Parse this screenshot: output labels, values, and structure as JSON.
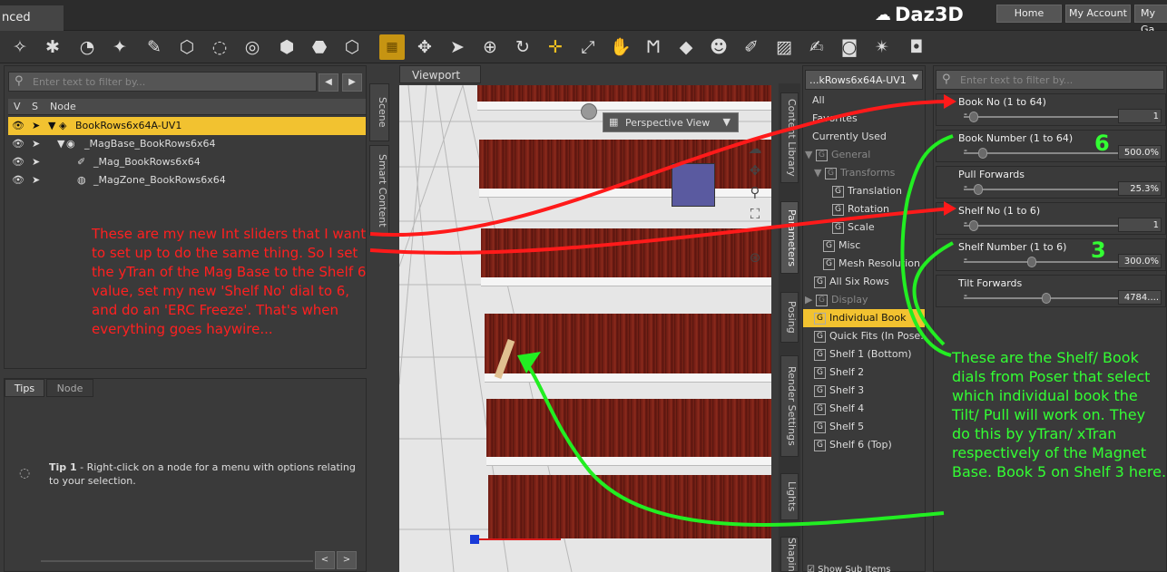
{
  "window": {
    "tab_title": "nced"
  },
  "header": {
    "logo": "Daz3D",
    "links": [
      {
        "label": "Home"
      },
      {
        "label": "My Account"
      },
      {
        "label": "My Ga"
      }
    ]
  },
  "scene": {
    "filter_placeholder": "Enter text to filter by...",
    "tabs": [
      "Scene",
      "Smart Content"
    ],
    "columns": [
      "V",
      "S",
      "Node"
    ],
    "nodes": [
      {
        "label": "BookRows6x64A-UV1"
      },
      {
        "label": "_MagBase_BookRows6x64"
      },
      {
        "label": "_Mag_BookRows6x64"
      },
      {
        "label": "_MagZone_BookRows6x64"
      }
    ]
  },
  "tips": {
    "tabs": [
      "Tips",
      "Node"
    ],
    "tip_title": "Tip 1",
    "tip_text": "- Right-click on a node for a menu with options relating to your selection."
  },
  "viewport": {
    "title": "Viewport",
    "camera": "Perspective View"
  },
  "side_tabs": [
    "Content Library",
    "Parameters",
    "Posing",
    "Render Settings",
    "Lights",
    "Shaping"
  ],
  "params": {
    "node_select": "...kRows6x64A-UV1",
    "filter_placeholder": "Enter text to filter by...",
    "categories": [
      {
        "label": "All"
      },
      {
        "label": "Favorites"
      },
      {
        "label": "Currently Used"
      },
      {
        "label": "General"
      },
      {
        "label": "Transforms"
      },
      {
        "label": "Translation"
      },
      {
        "label": "Rotation"
      },
      {
        "label": "Scale"
      },
      {
        "label": "Misc"
      },
      {
        "label": "Mesh Resolution"
      },
      {
        "label": "All Six Rows"
      },
      {
        "label": "Display"
      },
      {
        "label": "Individual Book"
      },
      {
        "label": "Quick Fits (In Pose..."
      },
      {
        "label": "Shelf 1 (Bottom)"
      },
      {
        "label": "Shelf 2"
      },
      {
        "label": "Shelf 3"
      },
      {
        "label": "Shelf 4"
      },
      {
        "label": "Shelf 5"
      },
      {
        "label": "Shelf 6 (Top)"
      }
    ],
    "show_sub_items": "Show Sub Items",
    "dials": [
      {
        "label": "Book No (1 to 64)",
        "value": "1",
        "level": 0.0
      },
      {
        "label": "Book Number (1 to 64)",
        "value": "500.0%",
        "level": 0.06
      },
      {
        "label": "Pull Forwards",
        "value": "25.3%",
        "level": 0.03
      },
      {
        "label": "Shelf No (1 to 6)",
        "value": "1",
        "level": 0.0
      },
      {
        "label": "Shelf Number (1 to 6)",
        "value": "300.0%",
        "level": 0.4
      },
      {
        "label": "Tilt Forwards",
        "value": "4784....",
        "level": 0.5
      }
    ]
  },
  "annotations": {
    "red": "These are my new Int sliders that I want to set up to do the same thing. So I set the yTran of the Mag Base to the Shelf 6 value, set my new 'Shelf No' dial to 6, and do an 'ERC Freeze'. That's when everything goes haywire...",
    "green": "These are the Shelf/ Book dials from Poser that select which individual book the Tilt/ Pull will work on. They do this by yTran/ xTran respectively of the Magnet Base. Book 5 on Shelf 3 here.",
    "num_book": "6",
    "num_shelf": "3",
    "colors": {
      "red": "#ff2020",
      "green": "#33ff33",
      "selection": "#f2c230"
    }
  }
}
